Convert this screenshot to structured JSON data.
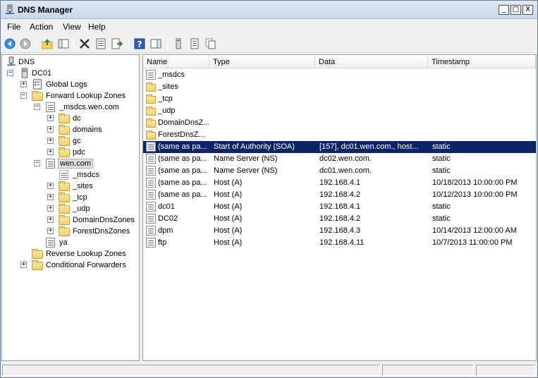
{
  "window": {
    "title": "DNS Manager"
  },
  "menu": {
    "file": "File",
    "action": "Action",
    "view": "View",
    "help": "Help"
  },
  "title_controls": {
    "minimize": "_",
    "maximize": "□",
    "close": "X"
  },
  "tree": {
    "root": "DNS",
    "server": "DC01",
    "global_logs": "Global Logs",
    "forward_zones": "Forward Lookup Zones",
    "msdcs_zone": "_msdcs.wen.com",
    "msdcs_children": [
      "dc",
      "domains",
      "gc",
      "pdc"
    ],
    "wen_zone": "wen.com",
    "wen_children": [
      "_msdcs",
      "_sites",
      "_tcp",
      "_udp",
      "DomainDnsZones",
      "ForestDnsZones"
    ],
    "ya": "ya",
    "reverse_zones": "Reverse Lookup Zones",
    "conditional_forwarders": "Conditional Forwarders"
  },
  "columns": {
    "name": "Name",
    "type": "Type",
    "data": "Data",
    "timestamp": "Timestamp"
  },
  "records": [
    {
      "name": "_msdcs",
      "type": "",
      "data": "",
      "timestamp": "",
      "icon": "zone-icon"
    },
    {
      "name": "_sites",
      "type": "",
      "data": "",
      "timestamp": "",
      "icon": "folder-icon"
    },
    {
      "name": "_tcp",
      "type": "",
      "data": "",
      "timestamp": "",
      "icon": "folder-icon"
    },
    {
      "name": "_udp",
      "type": "",
      "data": "",
      "timestamp": "",
      "icon": "folder-icon"
    },
    {
      "name": "DomainDnsZ...",
      "type": "",
      "data": "",
      "timestamp": "",
      "icon": "folder-icon"
    },
    {
      "name": "ForestDnsZ...",
      "type": "",
      "data": "",
      "timestamp": "",
      "icon": "folder-icon"
    },
    {
      "name": "(same as pa...",
      "type": "Start of Authority (SOA)",
      "data": "[157], dc01.wen.com., host...",
      "timestamp": "static",
      "icon": "record-icon"
    },
    {
      "name": "(same as pa...",
      "type": "Name Server (NS)",
      "data": "dc02.wen.com.",
      "timestamp": "static",
      "icon": "record-icon"
    },
    {
      "name": "(same as pa...",
      "type": "Name Server (NS)",
      "data": "dc01.wen.com.",
      "timestamp": "static",
      "icon": "record-icon"
    },
    {
      "name": "(same as pa...",
      "type": "Host (A)",
      "data": "192.168.4.1",
      "timestamp": "10/18/2013 10:00:00 PM",
      "icon": "record-icon"
    },
    {
      "name": "(same as pa...",
      "type": "Host (A)",
      "data": "192.168.4.2",
      "timestamp": "10/12/2013 10:00:00 PM",
      "icon": "record-icon"
    },
    {
      "name": "dc01",
      "type": "Host (A)",
      "data": "192.168.4.1",
      "timestamp": "static",
      "icon": "record-icon"
    },
    {
      "name": "DC02",
      "type": "Host (A)",
      "data": "192.168.4.2",
      "timestamp": "static",
      "icon": "record-icon"
    },
    {
      "name": "dpm",
      "type": "Host (A)",
      "data": "192.168.4.3",
      "timestamp": "10/14/2013 12:00:00 AM",
      "icon": "record-icon"
    },
    {
      "name": "ftp",
      "type": "Host (A)",
      "data": "192.168.4.11",
      "timestamp": "10/7/2013 11:00:00 PM",
      "icon": "record-icon"
    }
  ],
  "selected_record_index": 6,
  "colors": {
    "selection": "#0a246a",
    "folder": "#f3cf6a"
  }
}
